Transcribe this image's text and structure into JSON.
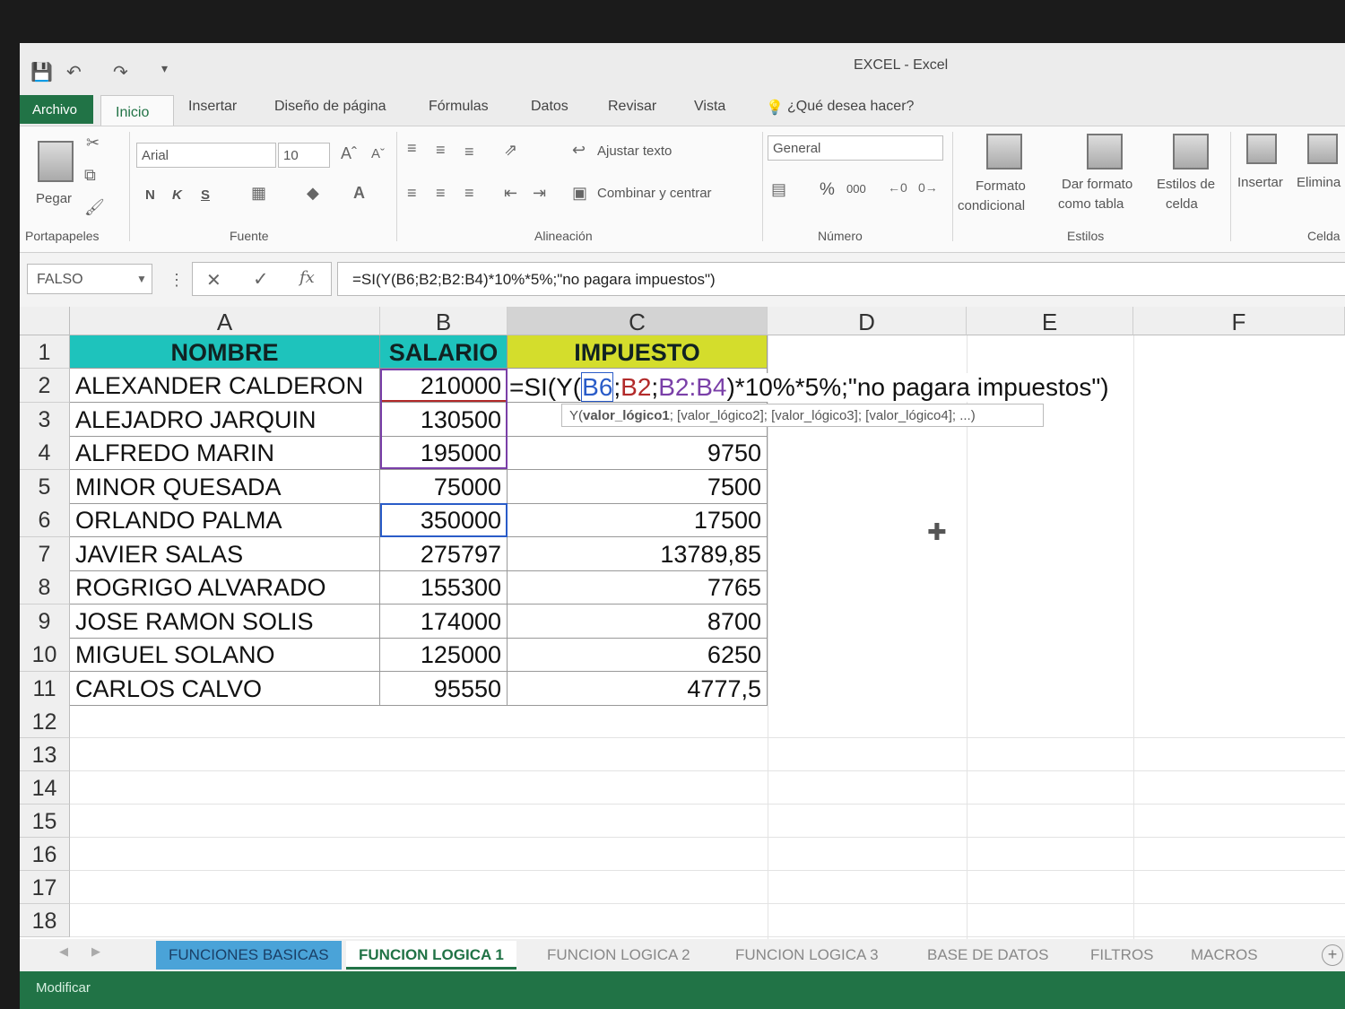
{
  "window": {
    "title": "EXCEL - Excel"
  },
  "ribbon": {
    "tabs": [
      "Archivo",
      "Inicio",
      "Insertar",
      "Diseño de página",
      "Fórmulas",
      "Datos",
      "Revisar",
      "Vista"
    ],
    "tell_me": "¿Qué desea hacer?",
    "clipboard": {
      "paste": "Pegar",
      "group": "Portapapeles"
    },
    "font": {
      "name": "Arial",
      "size": "10",
      "bold": "N",
      "italic": "K",
      "underline": "S",
      "group": "Fuente"
    },
    "alignment": {
      "wrap": "Ajustar texto",
      "merge": "Combinar y centrar",
      "group": "Alineación"
    },
    "number": {
      "format": "General",
      "group": "Número"
    },
    "styles": {
      "cond_l1": "Formato",
      "cond_l2": "condicional",
      "table_l1": "Dar formato",
      "table_l2": "como tabla",
      "cell_l1": "Estilos de",
      "cell_l2": "celda",
      "group": "Estilos"
    },
    "cells": {
      "insert": "Insertar",
      "delete": "Elimina",
      "group": "Celda"
    }
  },
  "formula_bar": {
    "name_box": "FALSO",
    "formula": "=SI(Y(B6;B2;B2:B4)*10%*5%;\"no pagara impuestos\")"
  },
  "columns": [
    "A",
    "B",
    "C",
    "D",
    "E",
    "F"
  ],
  "headers": {
    "a1": "NOMBRE",
    "b1": "SALARIO",
    "c1": "IMPUESTO"
  },
  "rows": [
    {
      "n": "2",
      "name": "ALEXANDER CALDERON",
      "salary": "210000",
      "tax": ""
    },
    {
      "n": "3",
      "name": "ALEJADRO JARQUIN",
      "salary": "130500",
      "tax": ""
    },
    {
      "n": "4",
      "name": "ALFREDO MARIN",
      "salary": "195000",
      "tax": "9750"
    },
    {
      "n": "5",
      "name": "MINOR QUESADA",
      "salary": "75000",
      "tax": "7500"
    },
    {
      "n": "6",
      "name": "ORLANDO PALMA",
      "salary": "350000",
      "tax": "17500"
    },
    {
      "n": "7",
      "name": "JAVIER SALAS",
      "salary": "275797",
      "tax": "13789,85"
    },
    {
      "n": "8",
      "name": "ROGRIGO ALVARADO",
      "salary": "155300",
      "tax": "7765"
    },
    {
      "n": "9",
      "name": "JOSE RAMON SOLIS",
      "salary": "174000",
      "tax": "8700"
    },
    {
      "n": "10",
      "name": "MIGUEL SOLANO",
      "salary": "125000",
      "tax": "6250"
    },
    {
      "n": "11",
      "name": "CARLOS CALVO",
      "salary": "95550",
      "tax": "4777,5"
    }
  ],
  "empty_rows": [
    "12",
    "13",
    "14",
    "15",
    "16",
    "17",
    "18"
  ],
  "editing": {
    "prefix": "=SI(Y(",
    "ref1": "B6",
    "sep1": ";",
    "ref2": "B2",
    "sep2": ";",
    "ref3": "B2:B4",
    "suffix": ")*10%*5%;\"no pagara impuestos\")",
    "tooltip_fn": "Y(",
    "tooltip_bold": "valor_lógico1",
    "tooltip_rest": "; [valor_lógico2]; [valor_lógico3]; [valor_lógico4]; ...)"
  },
  "sheet_tabs": [
    "FUNCIONES BASICAS",
    "FUNCION LOGICA 1",
    "FUNCION LOGICA 2",
    "FUNCION LOGICA 3",
    "BASE DE DATOS",
    "FILTROS",
    "MACROS"
  ],
  "status": {
    "mode": "Modificar"
  },
  "colors": {
    "accent": "#217346",
    "header_cyan": "#1ec3bc",
    "header_yellow": "#d4dd2c",
    "ref_blue": "#2a5cc8",
    "ref_red": "#b22a2a",
    "ref_purple": "#7a3fa8"
  }
}
